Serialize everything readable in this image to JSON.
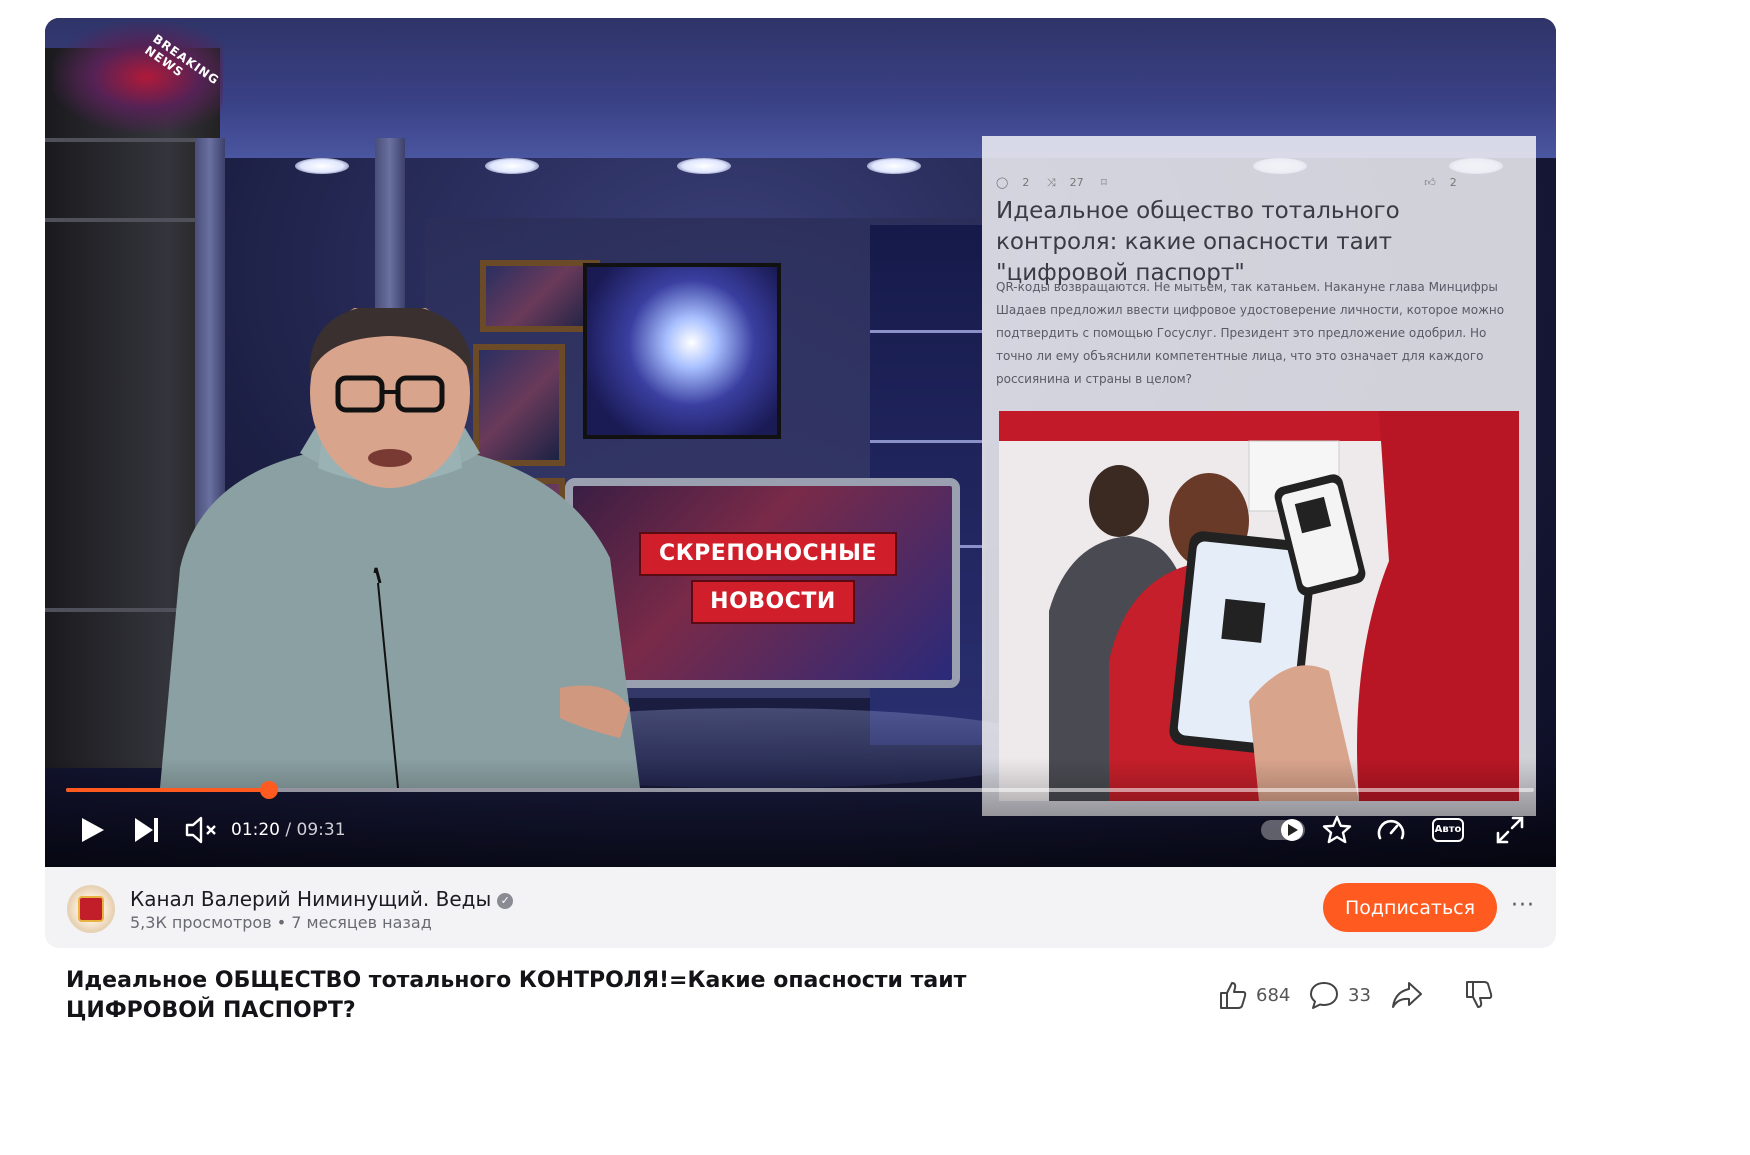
{
  "player": {
    "breaking_news": "BREAKING NEWS",
    "badge_line1": "СКРЕПОНОСНЫЕ",
    "badge_line2": "НОВОСТИ",
    "article": {
      "meta_comments": "2",
      "meta_reposts": "27",
      "meta_likes": "2",
      "title": "Идеальное общество тотального контроля: какие опасности таит \"цифровой паспорт\"",
      "body": "QR-коды возвращаются. Не мытьем, так катаньем. Накануне глава Минцифры Шадаев предложил ввести цифровое удостоверение личности, которое можно подтвердить с помощью Госуслуг. Президент это предложение одобрил. Но точно ли ему объяснили компетентные лица, что это означает для каждого россиянина и страны в целом?"
    },
    "progress": 0.138,
    "current_time": "01:20",
    "separator": " / ",
    "total_time": "09:31",
    "quality_label": "Авто",
    "accent_color": "#ff5a1f"
  },
  "channel": {
    "name": "Канал Валерий Ниминущий. Веды",
    "verified_icon": "✓",
    "views": "5,3К просмотров",
    "dot": " • ",
    "published": "7 месяцев назад",
    "subscribe_label": "Подписаться",
    "more_label": "···"
  },
  "video": {
    "title": "Идеальное ОБЩЕСТВО тотального КОНТРОЛЯ!=Какие опасности таит ЦИФРОВОЙ ПАСПОРТ?",
    "likes": "684",
    "comments": "33"
  }
}
